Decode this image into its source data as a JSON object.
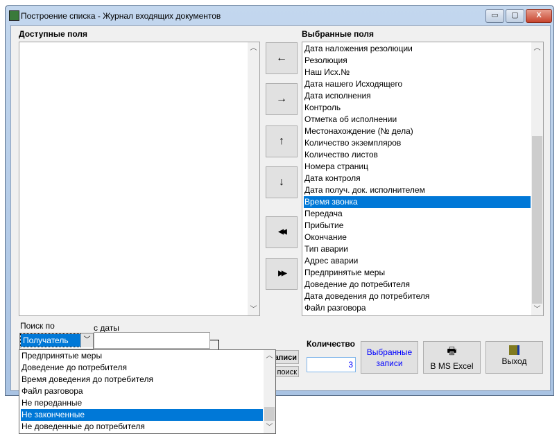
{
  "window": {
    "title": "Построение списка - Журнал входящих документов",
    "minimize": "▭",
    "maximize": "▢",
    "close": "X"
  },
  "available": {
    "label": "Доступные поля",
    "items": []
  },
  "selected": {
    "label": "Выбранные поля",
    "items": [
      "Дата наложения резолюции",
      "Резолюция",
      "Наш Исх.№",
      "Дата нашего Исходящего",
      "Дата исполнения",
      "Контроль",
      "Отметка об исполнении",
      "Местонахождение (№ дела)",
      "Количество экземпляров",
      "Количество листов",
      "Номера страниц",
      "Дата контроля",
      "Дата получ. док. исполнителем",
      "Время звонка",
      "Передача",
      "Прибытие",
      "Окончание",
      "Тип аварии",
      "Адрес аварии",
      "Предпринятые меры",
      "Доведение до потребителя",
      "Дата доведения до потребителя",
      "Файл разговора"
    ],
    "selected_index": 13
  },
  "move_buttons": {
    "left": "←",
    "right": "→",
    "up": "↑",
    "down": "↓",
    "all_left": "◀◀",
    "all_right": "▶▶"
  },
  "search": {
    "label": "Поиск по",
    "value": "Получатель",
    "date_label": "с даты",
    "date_value": "",
    "hidden_btn1": "записи",
    "hidden_btn2": "поиск"
  },
  "dropdown": {
    "items": [
      "Предпринятые меры",
      "Доведение до потребителя",
      "Время доведения до потребителя",
      "Файл разговора",
      "Не переданные",
      "Не законченные",
      "Не доведенные до потребителя"
    ],
    "selected_index": 5
  },
  "count": {
    "label": "Количество",
    "value": "3"
  },
  "buttons": {
    "selected_records": "Выбранные записи",
    "excel": "В MS Excel",
    "exit": "Выход"
  },
  "colors": {
    "selection": "#0078d7",
    "link_text": "#0000ff"
  }
}
